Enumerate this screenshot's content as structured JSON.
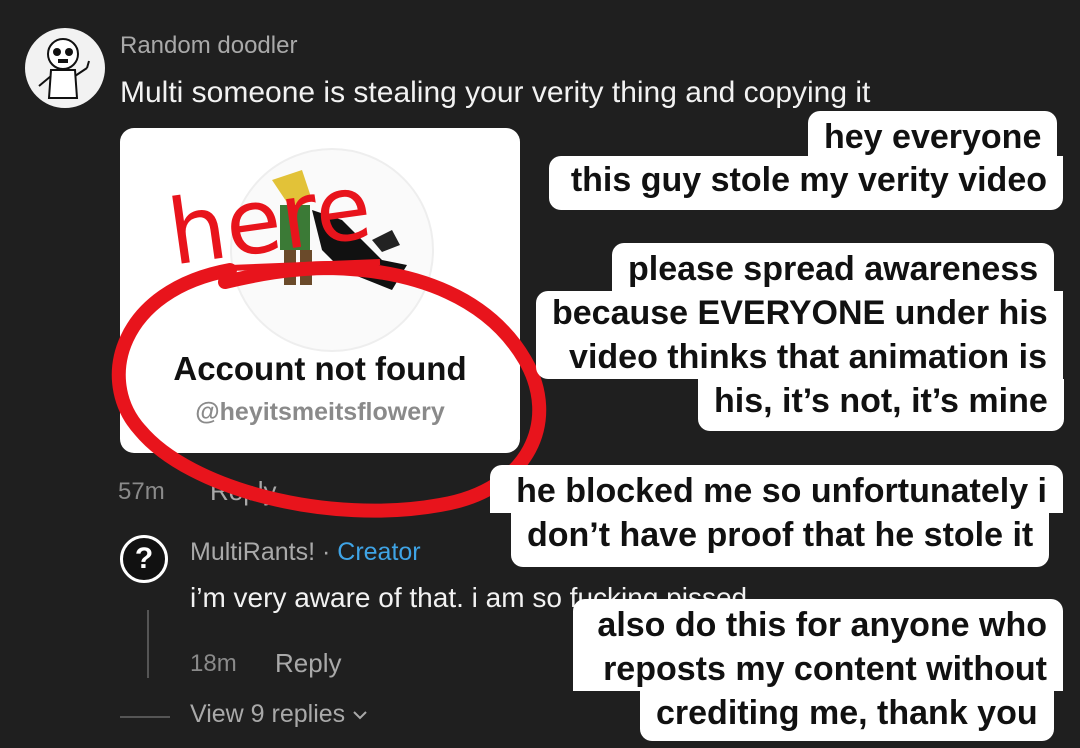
{
  "comment": {
    "username": "Random doodler",
    "text": "Multi someone is stealing your verity thing and copying it",
    "time": "57m",
    "reply_label": "Reply"
  },
  "card": {
    "title": "Account not found",
    "handle": "@heyitsmeitsflowery",
    "scribble_text": "here"
  },
  "reply": {
    "username": "MultiRants!",
    "separator": " · ",
    "badge": "Creator",
    "text": "i’m very aware of that. i am so fucking pissed",
    "time": "18m",
    "reply_label": "Reply",
    "view_replies": "View 9 replies"
  },
  "captions": [
    {
      "lines": [
        "hey everyone",
        "this guy stole my verity video"
      ]
    },
    {
      "lines": [
        "please spread awareness",
        "because EVERYONE under his",
        "video thinks that animation is",
        "his, it’s not, it’s mine"
      ]
    },
    {
      "lines": [
        "he blocked me so unfortunately i",
        "don’t have proof that he stole it"
      ]
    },
    {
      "lines": [
        "also do this for anyone who",
        "reposts my content without",
        "crediting me, thank you"
      ]
    }
  ],
  "colors": {
    "background": "#1f1f1f",
    "creator_badge": "#3fa4e6",
    "scribble": "#e8141c"
  }
}
